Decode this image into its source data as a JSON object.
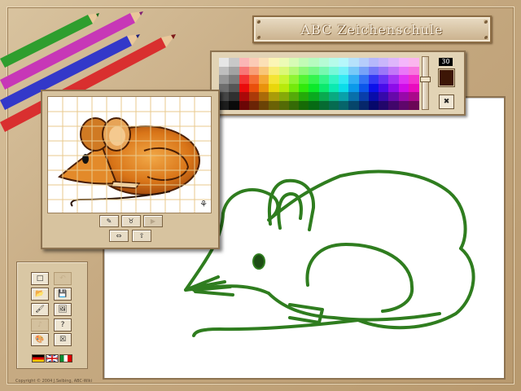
{
  "app": {
    "title": "ABC Zeichenschule",
    "copyright": "Copyright © 2004 J.Selbing, ABC-Wiki"
  },
  "palette": {
    "brush_size": "30",
    "current_color": "#3d1606",
    "reset_label": "✖",
    "size_slider_fraction": 0.42
  },
  "preview": {
    "buttons": [
      {
        "name": "preview-pencil-button",
        "icon": "pencil-icon",
        "glyph": "✎",
        "enabled": true
      },
      {
        "name": "preview-mouse-button",
        "icon": "mouse-icon",
        "glyph": "♉",
        "enabled": true
      },
      {
        "name": "preview-next-button",
        "icon": "play-icon",
        "glyph": "▶",
        "enabled": false
      },
      {
        "name": "preview-flip-button",
        "icon": "flip-icon",
        "glyph": "⇔",
        "enabled": true
      },
      {
        "name": "preview-upload-button",
        "icon": "upload-icon",
        "glyph": "⇧",
        "enabled": true
      }
    ]
  },
  "tools": {
    "new_label": "□",
    "undo_label": "↶",
    "open_label": "📂",
    "save_label": "💾",
    "brush_label": "🖌",
    "image_label": "🖼",
    "disabled_label": "♪",
    "help_label": "?",
    "palette_label": "🎨",
    "exit_label": "☒"
  },
  "colors": {
    "drawing_stroke": "#2f7d1f",
    "panel_border": "#8d7351",
    "background": "#c7ab83"
  }
}
